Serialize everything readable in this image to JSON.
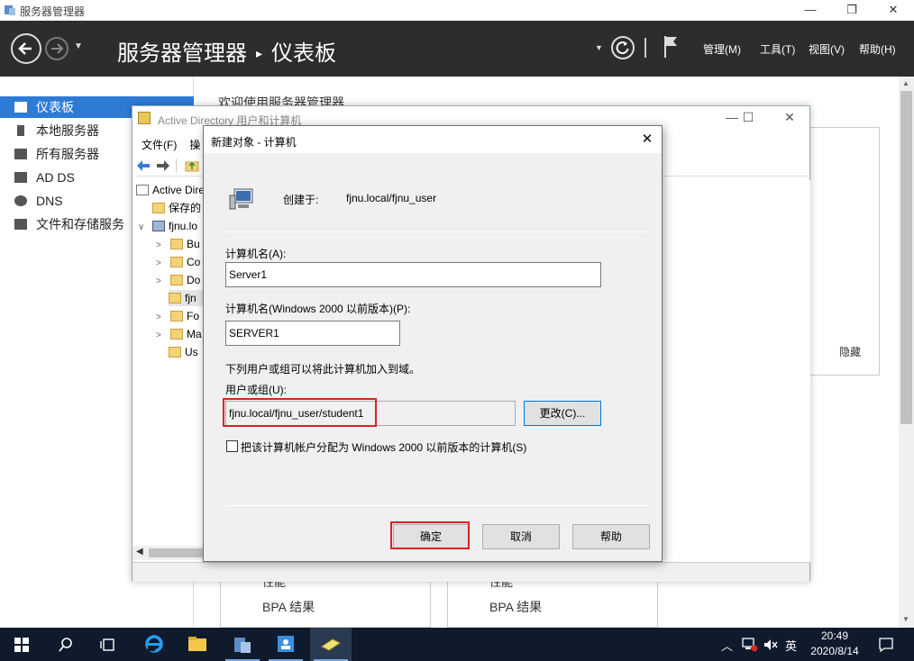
{
  "sm": {
    "window_title": "服务器管理器",
    "breadcrumb_root": "服务器管理器",
    "breadcrumb_sep": "▸",
    "breadcrumb_current": "仪表板",
    "menus": [
      "管理(M)",
      "工具(T)",
      "视图(V)",
      "帮助(H)"
    ],
    "sidebar": [
      {
        "label": "仪表板",
        "icon": "dashboard-icon",
        "active": true
      },
      {
        "label": "本地服务器",
        "icon": "server-icon"
      },
      {
        "label": "所有服务器",
        "icon": "servers-icon"
      },
      {
        "label": "AD DS",
        "icon": "adds-icon"
      },
      {
        "label": "DNS",
        "icon": "dns-icon"
      },
      {
        "label": "文件和存储服务",
        "icon": "storage-icon"
      }
    ],
    "welcome": "欢迎使用服务器管理器",
    "hide_link": "隐藏",
    "tiles": [
      {
        "perf": "性能",
        "bpa": "BPA 结果"
      },
      {
        "perf": "性能",
        "bpa": "BPA 结果"
      }
    ]
  },
  "aduc": {
    "title": "Active Directory 用户和计算机",
    "menu": [
      "文件(F)",
      "操"
    ],
    "tree": [
      {
        "label": "Active Direc",
        "indent": 0,
        "exp": ""
      },
      {
        "label": "保存的",
        "indent": 1,
        "exp": ""
      },
      {
        "label": "fjnu.lo",
        "indent": 0,
        "exp": "∨"
      },
      {
        "label": "Bu",
        "indent": 1,
        "exp": ">"
      },
      {
        "label": "Co",
        "indent": 1,
        "exp": ">"
      },
      {
        "label": "Do",
        "indent": 1,
        "exp": ">"
      },
      {
        "label": "fjn",
        "indent": 1,
        "exp": "",
        "selected": true
      },
      {
        "label": "Fo",
        "indent": 1,
        "exp": ">"
      },
      {
        "label": "Ma",
        "indent": 1,
        "exp": ">"
      },
      {
        "label": "Us",
        "indent": 1,
        "exp": ""
      }
    ]
  },
  "dialog": {
    "title": "新建对象 - 计算机",
    "created_in_label": "创建于:",
    "created_in_value": "fjnu.local/fjnu_user",
    "computer_name_label": "计算机名(A):",
    "computer_name_value": "Server1",
    "legacy_name_label": "计算机名(Windows 2000 以前版本)(P):",
    "legacy_name_value": "SERVER1",
    "join_hint": "下列用户或组可以将此计算机加入到域。",
    "user_group_label": "用户或组(U):",
    "user_group_value": "fjnu.local/fjnu_user/student1",
    "change_button": "更改(C)...",
    "legacy_checkbox_label": "把该计算机帐户分配为 Windows 2000 以前版本的计算机(S)",
    "ok_button": "确定",
    "cancel_button": "取消",
    "help_button": "帮助"
  },
  "taskbar": {
    "ime": "英",
    "time": "20:49",
    "date": "2020/8/14"
  },
  "colors": {
    "header_bg": "#2d2d30",
    "sidebar_active": "#2e7bd6",
    "highlight": "#e02020",
    "taskbar_bg": "#0f1b2d"
  }
}
